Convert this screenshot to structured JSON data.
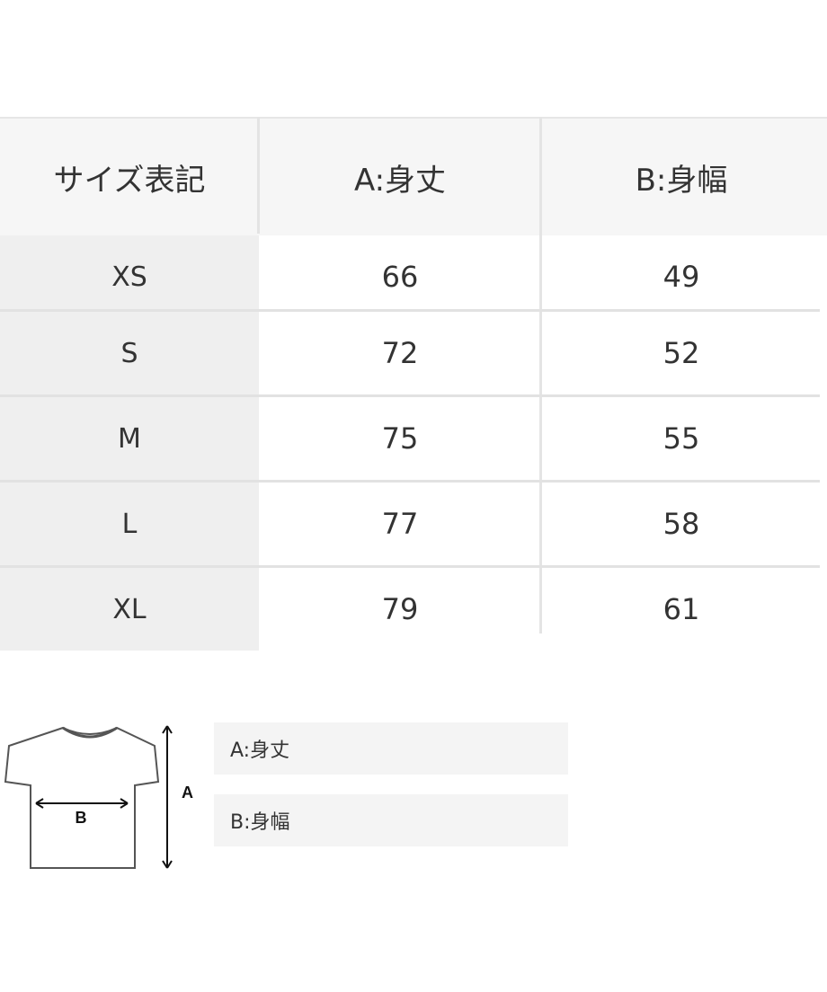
{
  "table": {
    "headers": [
      "サイズ表記",
      "A:身丈",
      "B:身幅"
    ],
    "rows": [
      {
        "size": "XS",
        "a": "66",
        "b": "49"
      },
      {
        "size": "S",
        "a": "72",
        "b": "52"
      },
      {
        "size": "M",
        "a": "75",
        "b": "55"
      },
      {
        "size": "L",
        "a": "77",
        "b": "58"
      },
      {
        "size": "XL",
        "a": "79",
        "b": "61"
      }
    ]
  },
  "diagram": {
    "label_a": "A",
    "label_b": "B"
  },
  "legend": {
    "a": "A:身丈",
    "b": "B:身幅"
  }
}
